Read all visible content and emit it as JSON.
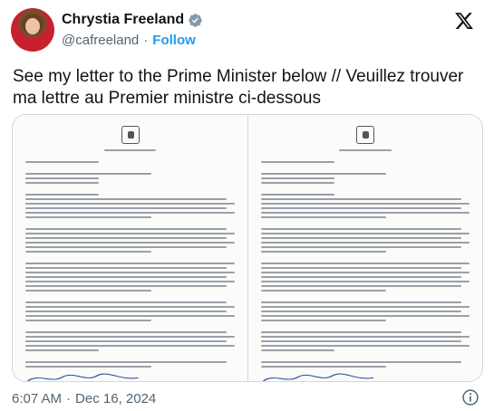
{
  "author": {
    "display_name": "Chrystia Freeland",
    "handle": "@cafreeland",
    "separator": "·",
    "follow_label": "Follow"
  },
  "tweet": {
    "text": "See my letter to the Prime Minister below // Veuillez trouver ma lettre au Premier ministre ci-dessous"
  },
  "footer": {
    "time": "6:07 AM",
    "separator": "·",
    "date": "Dec 16, 2024"
  },
  "icons": {
    "verified": "verified-badge-icon",
    "x_logo": "x-logo-icon",
    "info": "info-icon"
  },
  "colors": {
    "accent": "#1d9bf0",
    "text": "#0f1419",
    "muted": "#536471"
  }
}
